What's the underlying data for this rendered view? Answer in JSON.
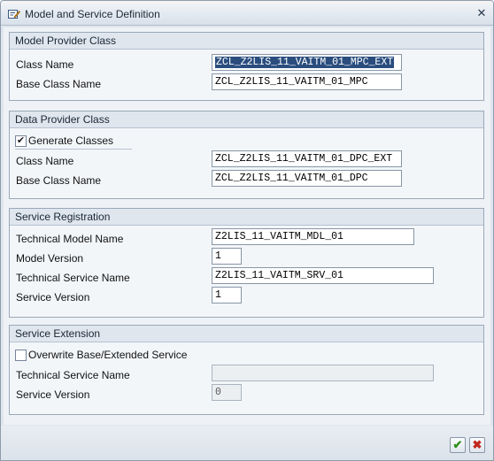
{
  "window": {
    "title": "Model and Service Definition",
    "close_glyph": "✕"
  },
  "model_provider": {
    "header": "Model Provider Class",
    "class_name_label": "Class Name",
    "class_name_value": "ZCL_Z2LIS_11_VAITM_01_MPC_EXT",
    "base_class_label": "Base Class Name",
    "base_class_value": "ZCL_Z2LIS_11_VAITM_01_MPC"
  },
  "data_provider": {
    "header": "Data Provider Class",
    "generate_label": "Generate Classes",
    "generate_checked": true,
    "class_name_label": "Class Name",
    "class_name_value": "ZCL_Z2LIS_11_VAITM_01_DPC_EXT",
    "base_class_label": "Base Class Name",
    "base_class_value": "ZCL_Z2LIS_11_VAITM_01_DPC"
  },
  "service_registration": {
    "header": "Service Registration",
    "tech_model_label": "Technical Model Name",
    "tech_model_value": "Z2LIS_11_VAITM_MDL_01",
    "model_version_label": "Model Version",
    "model_version_value": "1",
    "tech_service_label": "Technical Service Name",
    "tech_service_value": "Z2LIS_11_VAITM_SRV_01",
    "service_version_label": "Service Version",
    "service_version_value": "1"
  },
  "service_extension": {
    "header": "Service Extension",
    "overwrite_label": "Overwrite Base/Extended Service",
    "overwrite_checked": false,
    "tech_service_label": "Technical Service Name",
    "tech_service_value": "",
    "service_version_label": "Service Version",
    "service_version_value": "0"
  },
  "footer": {
    "ok_icon": "checkmark-icon",
    "ok_glyph": "✔",
    "cancel_icon": "cancel-icon",
    "cancel_glyph": "✖"
  }
}
